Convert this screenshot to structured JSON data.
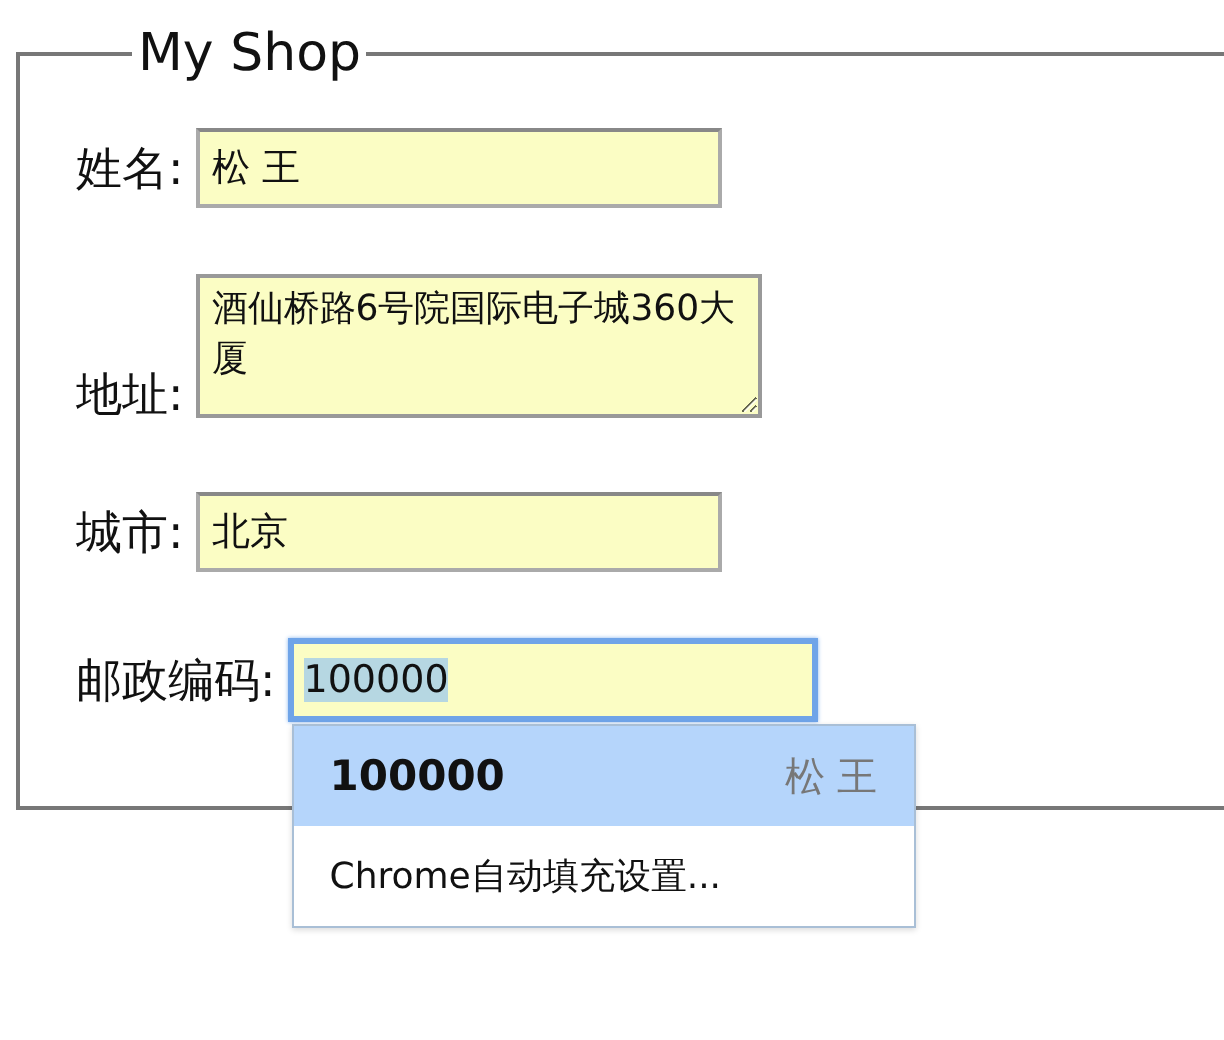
{
  "legend": "My Shop",
  "fields": [
    {
      "label": "姓名:",
      "value": "松 王",
      "kind": "input",
      "focused": false
    },
    {
      "label": "地址:",
      "value": "酒仙桥路6号院国际电子城360大厦",
      "kind": "textarea",
      "focused": false
    },
    {
      "label": "城市:",
      "value": "北京",
      "kind": "input",
      "focused": false
    },
    {
      "label": "邮政编码:",
      "value": "100000",
      "kind": "input",
      "focused": true,
      "text_selected": true
    }
  ],
  "autocomplete": {
    "items": [
      {
        "value": "100000",
        "hint": "松 王",
        "selected": true
      }
    ],
    "footer": "Chrome自动填充设置..."
  }
}
